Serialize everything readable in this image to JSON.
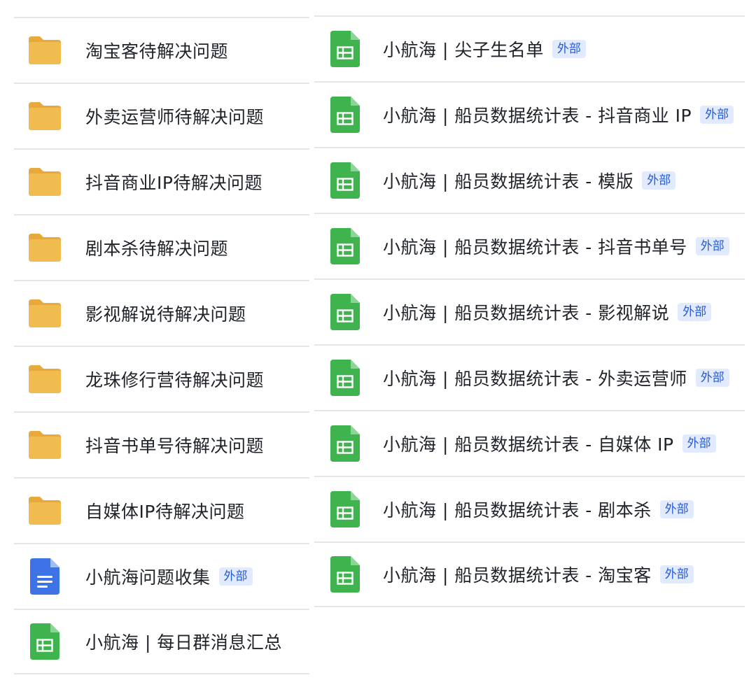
{
  "left_list": {
    "items": [
      {
        "name": "淘宝客待解决问题",
        "icon": "folder-icon",
        "badge": ""
      },
      {
        "name": "外卖运营师待解决问题",
        "icon": "folder-icon",
        "badge": ""
      },
      {
        "name": "抖音商业IP待解决问题",
        "icon": "folder-icon",
        "badge": ""
      },
      {
        "name": "剧本杀待解决问题",
        "icon": "folder-icon",
        "badge": ""
      },
      {
        "name": "影视解说待解决问题",
        "icon": "folder-icon",
        "badge": ""
      },
      {
        "name": "龙珠修行营待解决问题",
        "icon": "folder-icon",
        "badge": ""
      },
      {
        "name": "抖音书单号待解决问题",
        "icon": "folder-icon",
        "badge": ""
      },
      {
        "name": "自媒体IP待解决问题",
        "icon": "folder-icon",
        "badge": ""
      },
      {
        "name": "小航海问题收集",
        "icon": "doc-icon",
        "badge": "外部"
      },
      {
        "name": "小航海 | 每日群消息汇总",
        "icon": "sheet-icon",
        "badge": ""
      }
    ]
  },
  "right_list": {
    "items": [
      {
        "name": "小航海 | 尖子生名单",
        "icon": "sheet-icon",
        "badge": "外部"
      },
      {
        "name": "小航海 | 船员数据统计表 - 抖音商业 IP",
        "icon": "sheet-icon",
        "badge": "外部"
      },
      {
        "name": "小航海 | 船员数据统计表 - 模版",
        "icon": "sheet-icon",
        "badge": "外部"
      },
      {
        "name": "小航海 | 船员数据统计表 - 抖音书单号",
        "icon": "sheet-icon",
        "badge": "外部"
      },
      {
        "name": "小航海 | 船员数据统计表 - 影视解说",
        "icon": "sheet-icon",
        "badge": "外部"
      },
      {
        "name": "小航海 | 船员数据统计表 - 外卖运营师",
        "icon": "sheet-icon",
        "badge": "外部"
      },
      {
        "name": "小航海 | 船员数据统计表 - 自媒体 IP",
        "icon": "sheet-icon",
        "badge": "外部"
      },
      {
        "name": "小航海 | 船员数据统计表 - 剧本杀",
        "icon": "sheet-icon",
        "badge": "外部"
      },
      {
        "name": "小航海 | 船员数据统计表 - 淘宝客",
        "icon": "sheet-icon",
        "badge": "外部"
      }
    ]
  },
  "colors": {
    "folder": "#f0bb4f",
    "folder_tab": "#e7a93c",
    "doc": "#3e73e8",
    "sheet": "#3fb44e",
    "sheet_fold": "#8bd596",
    "badge_bg": "#e1eaff",
    "badge_text": "#245bdb"
  }
}
